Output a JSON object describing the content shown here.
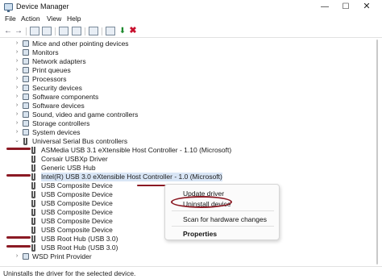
{
  "window": {
    "title": "Device Manager",
    "min_glyph": "—",
    "max_glyph": "☐",
    "close_glyph": "✕"
  },
  "menubar": [
    "File",
    "Action",
    "View",
    "Help"
  ],
  "toolbar": {
    "back_glyph": "←",
    "forward_glyph": "→",
    "scan_glyph": "⬇",
    "remove_glyph": "✖"
  },
  "tree": {
    "categories_above": [
      "Mice and other pointing devices",
      "Monitors",
      "Network adapters",
      "Print queues",
      "Processors",
      "Security devices",
      "Software components",
      "Software devices",
      "Sound, video and game controllers",
      "Storage controllers",
      "System devices"
    ],
    "usb_category": "Universal Serial Bus controllers",
    "usb_devices": [
      "ASMedia USB 3.1 eXtensible Host Controller - 1.10 (Microsoft)",
      "Corsair USBXp Driver",
      "Generic USB Hub",
      "Intel(R) USB 3.0 eXtensible Host Controller - 1.0 (Microsoft)",
      "USB Composite Device",
      "USB Composite Device",
      "USB Composite Device",
      "USB Composite Device",
      "USB Composite Device",
      "USB Composite Device",
      "USB Root Hub (USB 3.0)",
      "USB Root Hub (USB 3.0)"
    ],
    "last_category": "WSD Print Provider",
    "expand_glyph": "›",
    "collapse_glyph": "⌄"
  },
  "context_menu": {
    "items": [
      "Update driver",
      "Uninstall device",
      "Scan for hardware changes",
      "Properties"
    ]
  },
  "status": {
    "text": "Uninstalls the driver for the selected device."
  },
  "colors": {
    "annotation": "#8b1a24",
    "selection": "#d9e6f6"
  }
}
